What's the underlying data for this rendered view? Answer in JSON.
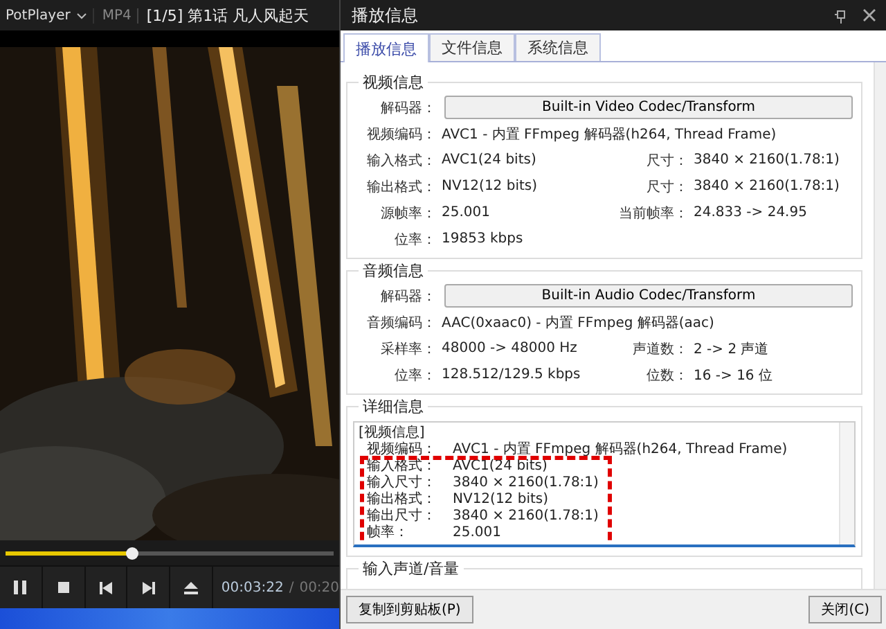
{
  "player": {
    "menu": "PotPlayer",
    "format": "MP4",
    "title": "[1/5] 第1话 凡人风起天",
    "progress": {
      "level": 0.39
    },
    "time_current": "00:03:22",
    "time_separator": "/",
    "time_total": "00:20"
  },
  "dialog": {
    "title": "播放信息",
    "tabs": [
      {
        "label": "播放信息",
        "selected": true
      },
      {
        "label": "文件信息",
        "selected": false
      },
      {
        "label": "系统信息",
        "selected": false
      }
    ],
    "video": {
      "heading": "视频信息",
      "decoder_label": "解码器：",
      "decoder": "Built-in Video Codec/Transform",
      "codec": {
        "label": "视频编码：",
        "value": "AVC1 - 内置 FFmpeg 解码器(h264, Thread Frame)"
      },
      "rows": [
        [
          {
            "label": "输入格式：",
            "value": "AVC1(24 bits)"
          },
          {
            "label": "尺寸：",
            "value": "3840 × 2160(1.78:1)"
          }
        ],
        [
          {
            "label": "输出格式：",
            "value": "NV12(12 bits)"
          },
          {
            "label": "尺寸：",
            "value": "3840 × 2160(1.78:1)"
          }
        ],
        [
          {
            "label": "源帧率：",
            "value": "25.001"
          },
          {
            "label": "当前帧率：",
            "value": "24.833 -> 24.95"
          }
        ],
        [
          {
            "label": "位率：",
            "value": "19853 kbps"
          }
        ]
      ]
    },
    "audio": {
      "heading": "音频信息",
      "decoder_label": "解码器：",
      "decoder": "Built-in Audio Codec/Transform",
      "codec": {
        "label": "音频编码：",
        "value": "AAC(0xaac0) - 内置 FFmpeg 解码器(aac)"
      },
      "rows": [
        [
          {
            "label": "采样率：",
            "value": "48000 -> 48000 Hz"
          },
          {
            "label": "声道数：",
            "value": "2 -> 2 声道"
          }
        ],
        [
          {
            "label": "位率：",
            "value": "128.512/129.5 kbps"
          },
          {
            "label": "位数：",
            "value": "16 -> 16 位"
          }
        ]
      ]
    },
    "detail": {
      "heading": "详细信息",
      "lines": [
        {
          "kind": "header",
          "text": "[视频信息]"
        },
        {
          "kind": "field",
          "label": "视频编码：",
          "value": "AVC1 - 内置 FFmpeg 解码器(h264, Thread Frame)"
        },
        {
          "kind": "field",
          "label": "输入格式：",
          "value": "AVC1(24 bits)"
        },
        {
          "kind": "field",
          "label": "输入尺寸：",
          "value": "3840 × 2160(1.78:1)"
        },
        {
          "kind": "field",
          "label": "输出格式：",
          "value": "NV12(12 bits)"
        },
        {
          "kind": "field",
          "label": "输出尺寸：",
          "value": "3840 × 2160(1.78:1)"
        },
        {
          "kind": "field",
          "label": "帧率：",
          "value": "25.001"
        }
      ]
    },
    "input": {
      "heading": "输入声道/音量"
    },
    "buttons": [
      {
        "label": "复制到剪贴板(P)"
      },
      {
        "label": "关闭(C)"
      }
    ]
  }
}
